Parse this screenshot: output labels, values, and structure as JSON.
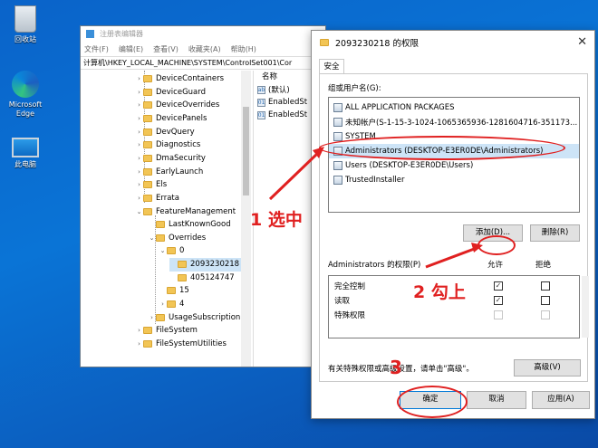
{
  "desktop": {
    "icons": [
      {
        "label": "回收站",
        "icon": "recycle-bin-icon"
      },
      {
        "label": "Microsoft Edge",
        "icon": "edge-icon"
      },
      {
        "label": "此电脑",
        "icon": "computer-icon"
      }
    ]
  },
  "regedit": {
    "title": "注册表编辑器",
    "menu": [
      "文件(F)",
      "编辑(E)",
      "查看(V)",
      "收藏夹(A)",
      "帮助(H)"
    ],
    "address": "计算机\\HKEY_LOCAL_MACHINE\\SYSTEM\\ControlSet001\\Cor",
    "tree": [
      "DeviceContainers",
      "DeviceGuard",
      "DeviceOverrides",
      "DevicePanels",
      "DevQuery",
      "Diagnostics",
      "DmaSecurity",
      "EarlyLaunch",
      "Els",
      "Errata",
      "FeatureManagement",
      "LastKnownGood",
      "Overrides",
      "0",
      "2093230218",
      "405124747",
      "15",
      "4",
      "UsageSubscription",
      "FileSystem",
      "FileSystemUtilities"
    ],
    "values_header": "名称",
    "values": [
      "(默认)",
      "EnabledSt",
      "EnabledSt"
    ]
  },
  "dialog": {
    "title": "2093230218 的权限",
    "close": "✕",
    "tab": "安全",
    "groups_label": "组或用户名(G):",
    "users": [
      "ALL APPLICATION PACKAGES",
      "未知帐户(S-1-15-3-1024-1065365936-1281604716-351173...",
      "SYSTEM",
      "Administrators (DESKTOP-E3ER0DE\\Administrators)",
      "Users (DESKTOP-E3ER0DE\\Users)",
      "TrustedInstaller"
    ],
    "add_button": "添加(D)...",
    "remove_button": "删除(R)",
    "perm_label": "Administrators 的权限(P)",
    "allow_header": "允许",
    "deny_header": "拒绝",
    "permissions": [
      {
        "name": "完全控制",
        "allow": true,
        "deny": false
      },
      {
        "name": "读取",
        "allow": true,
        "deny": false
      },
      {
        "name": "特殊权限",
        "allow": false,
        "deny": false
      }
    ],
    "advanced_note": "有关特殊权限或高级设置，请单击\"高级\"。",
    "advanced_button": "高级(V)",
    "ok_button": "确定",
    "cancel_button": "取消",
    "apply_button": "应用(A)"
  },
  "annotations": {
    "step1": "1 选中",
    "step2": "2 勾上",
    "step3": "3",
    "color": "#e02020"
  }
}
